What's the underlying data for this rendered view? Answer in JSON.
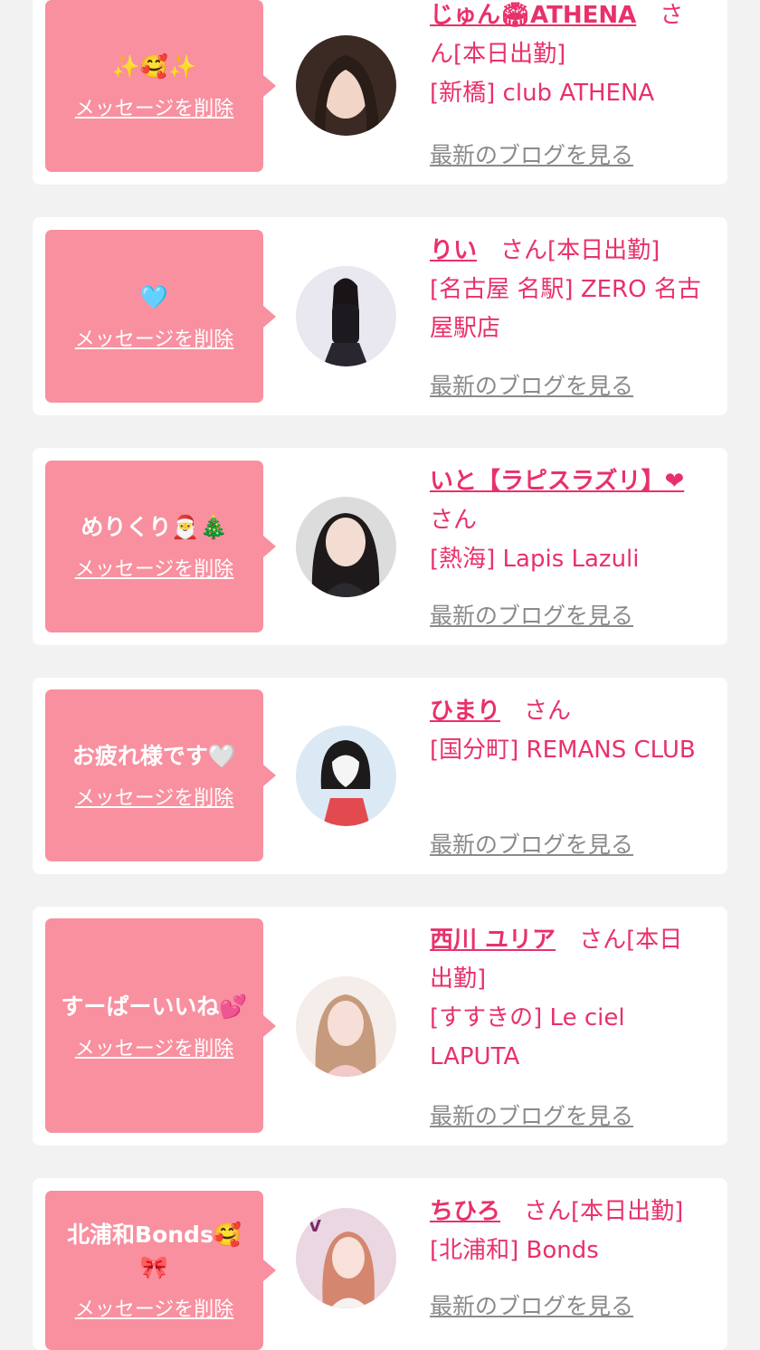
{
  "colors": {
    "accent": "#e8316a",
    "bubble": "#f8909f",
    "bg": "#f2f2f2"
  },
  "cards": [
    {
      "message": "✨🥰✨",
      "delete_label": "メッセージを削除",
      "name": "じゅん🏟ATHENA",
      "suffix": "　さん[本日出勤]",
      "shop": "[新橋] club ATHENA",
      "blog_label": "最新のブログを見る",
      "avatar": "avatar-photo"
    },
    {
      "message": "🩵",
      "delete_label": "メッセージを削除",
      "name": "りい",
      "suffix": "　さん[本日出勤]",
      "shop": "[名古屋 名駅] ZERO 名古屋駅店",
      "blog_label": "最新のブログを見る",
      "avatar": "avatar-photo"
    },
    {
      "message": "めりくり🎅🎄",
      "delete_label": "メッセージを削除",
      "name": "いと【ラピスラズリ】❤",
      "suffix": "　さん",
      "shop": "[熱海] Lapis Lazuli",
      "blog_label": "最新のブログを見る",
      "avatar": "avatar-photo"
    },
    {
      "message": "お疲れ様です🤍",
      "delete_label": "メッセージを削除",
      "name": "ひまり",
      "suffix": "　さん",
      "shop": "[国分町] REMANS CLUB",
      "blog_label": "最新のブログを見る",
      "avatar": "avatar-photo"
    },
    {
      "message": "すーぱーいいね💕",
      "delete_label": "メッセージを削除",
      "name": "西川 ユリア",
      "suffix": "　さん[本日出勤]",
      "shop": "[すすきの] Le ciel LAPUTA",
      "blog_label": "最新のブログを見る",
      "avatar": "avatar-photo"
    },
    {
      "message": "北浦和Bonds🥰\n🎀",
      "delete_label": "メッセージを削除",
      "name": "ちひろ",
      "suffix": "　さん[本日出勤]",
      "shop": "[北浦和] Bonds",
      "blog_label": "最新のブログを見る",
      "avatar": "avatar-photo"
    }
  ]
}
